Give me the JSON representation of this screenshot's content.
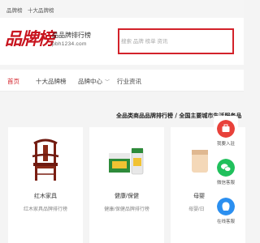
{
  "topbar": {
    "link1": "品牌榜",
    "link2": "十大品牌榜"
  },
  "header": {
    "logo_text": "品牌榜",
    "tagline": "品品牌排行榜",
    "url": "pbh1234.com"
  },
  "search": {
    "placeholder": "搜索 品牌 榜单 资讯"
  },
  "nav": {
    "items": [
      {
        "label": "首页"
      },
      {
        "label": "十大品牌榜"
      },
      {
        "label": "品牌中心"
      },
      {
        "label": "行业资讯"
      }
    ],
    "caret": "﹀"
  },
  "slogan": "全品类商品品牌排行榜 / 全国主要城市生活服务品",
  "cards": [
    {
      "name": "红木家具",
      "desc": "红木家具品牌排行榜"
    },
    {
      "name": "健康/保健",
      "desc": "健康/保健品牌排行榜"
    },
    {
      "name": "母婴",
      "desc": "母婴/日"
    }
  ],
  "float_bar": {
    "items": [
      {
        "label": "我要入驻",
        "icon": "register-icon"
      },
      {
        "label": "微信客服",
        "icon": "wechat-icon"
      },
      {
        "label": "在线客服",
        "icon": "chat-icon"
      }
    ]
  },
  "colors": {
    "brand_red": "#d3222a",
    "wechat_green": "#20c05c",
    "service_blue": "#2b8ff0"
  }
}
